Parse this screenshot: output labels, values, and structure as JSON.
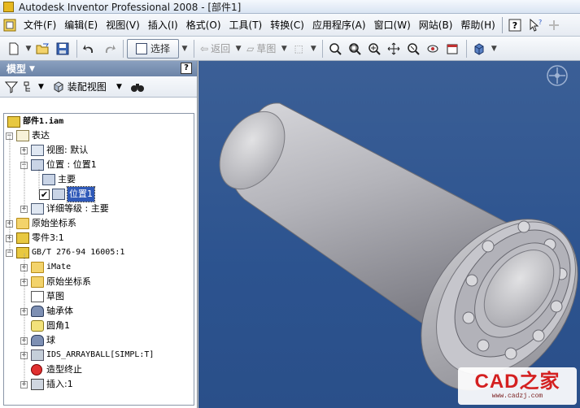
{
  "window": {
    "title": "Autodesk Inventor Professional 2008 - [部件1]"
  },
  "menubar": {
    "items": [
      "文件(F)",
      "编辑(E)",
      "视图(V)",
      "插入(I)",
      "格式(O)",
      "工具(T)",
      "转换(C)",
      "应用程序(A)",
      "窗口(W)",
      "网站(B)",
      "帮助(H)"
    ],
    "help_icon": "help-question-icon",
    "whatsthis_icon": "context-help-icon",
    "plus_icon": "plus-icon"
  },
  "toolbar": {
    "select_label": "选择",
    "return_label": "返回",
    "sketch_label": "草图"
  },
  "panel": {
    "title": "模型",
    "help_label": "?",
    "view_dropdown_label": "装配视图",
    "tree": [
      {
        "label": "部件1.iam",
        "icon": "assembly-icon"
      },
      {
        "label": "表达",
        "icon": "representation-icon"
      },
      {
        "label": "视图: 默认",
        "icon": "view-icon"
      },
      {
        "label": "位置 : 位置1",
        "icon": "position-icon"
      },
      {
        "label": "主要",
        "icon": "position-icon"
      },
      {
        "label": "位置1",
        "icon": "position-icon"
      },
      {
        "label": "详细等级 : 主要",
        "icon": "lod-icon"
      },
      {
        "label": "原始坐标系",
        "icon": "folder-icon"
      },
      {
        "label": "零件3:1",
        "icon": "part-icon"
      },
      {
        "label": "GB/T 276-94 16005:1",
        "icon": "part-icon"
      },
      {
        "label": "iMate",
        "icon": "folder-icon"
      },
      {
        "label": "原始坐标系",
        "icon": "folder-icon"
      },
      {
        "label": "草图",
        "icon": "sketch-icon"
      },
      {
        "label": "轴承体",
        "icon": "bearing-body-icon"
      },
      {
        "label": "圆角1",
        "icon": "fillet-icon"
      },
      {
        "label": "球",
        "icon": "ball-icon"
      },
      {
        "label": "IDS_ARRAYBALL[SIMPL:T]",
        "icon": "pattern-icon"
      },
      {
        "label": "造型终止",
        "icon": "end-of-part-icon"
      },
      {
        "label": "插入:1",
        "icon": "insert-icon"
      }
    ]
  },
  "watermark": {
    "main": "CAD之家",
    "sub": "www.cadzj.com"
  }
}
